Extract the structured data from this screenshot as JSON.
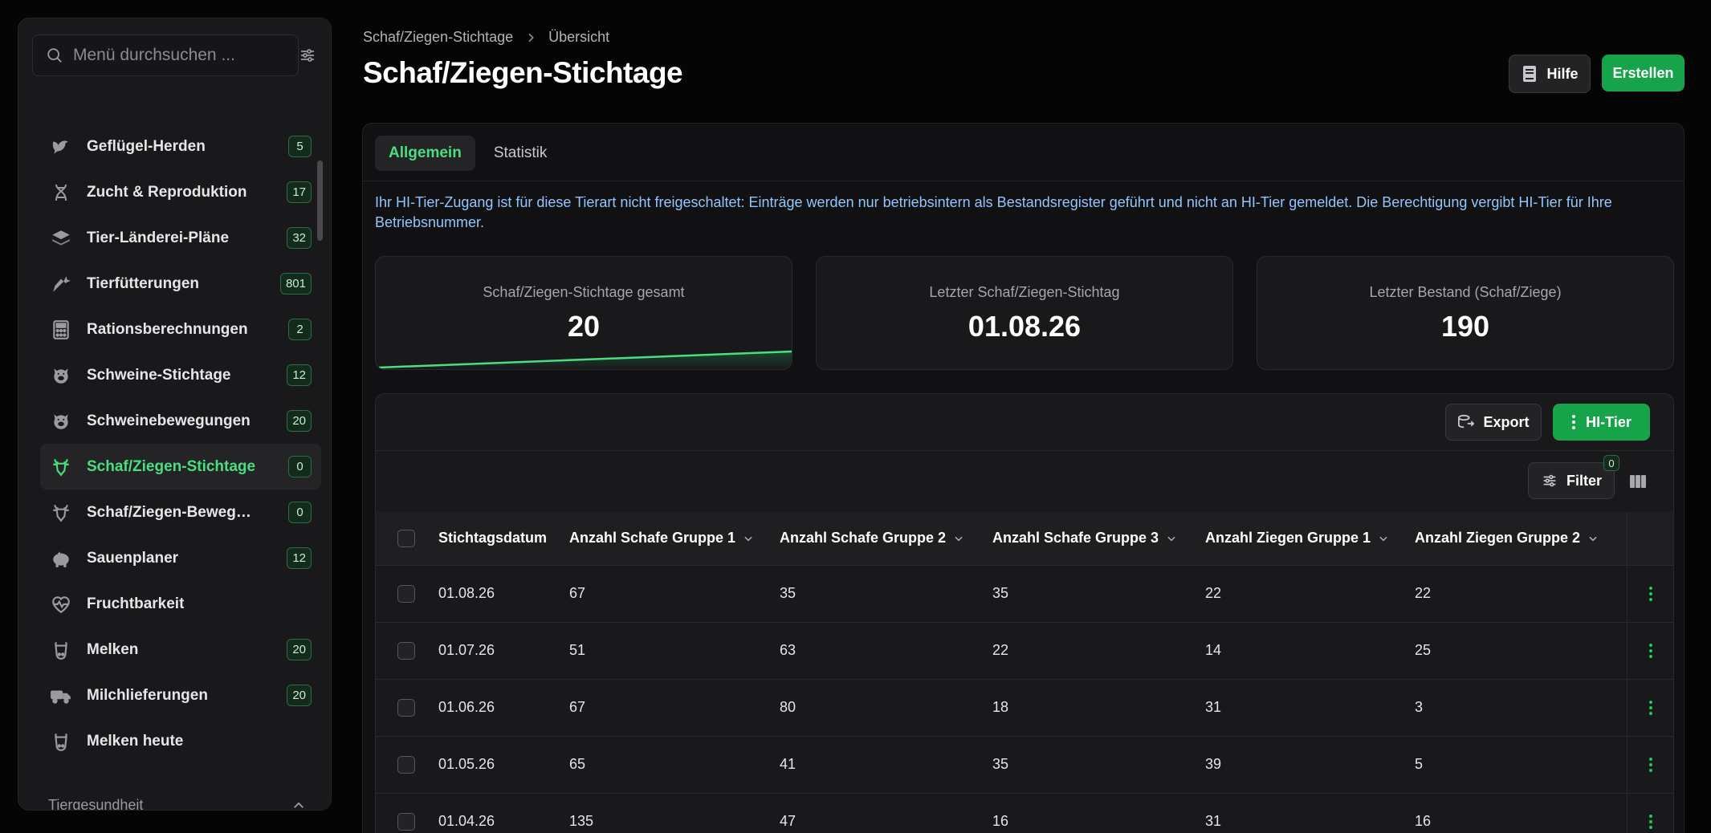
{
  "sidebar": {
    "search_placeholder": "Menü durchsuchen ...",
    "items": [
      {
        "label": "Geflügel-Herden",
        "badge": "5",
        "icon": "bird-icon"
      },
      {
        "label": "Zucht & Reproduktion",
        "badge": "17",
        "icon": "dna-icon"
      },
      {
        "label": "Tier-Länderei-Pläne",
        "badge": "32",
        "icon": "layers-icon"
      },
      {
        "label": "Tierfütterungen",
        "badge": "801",
        "icon": "carrot-icon"
      },
      {
        "label": "Rationsberechnungen",
        "badge": "2",
        "icon": "calculator-icon"
      },
      {
        "label": "Schweine-Stichtage",
        "badge": "12",
        "icon": "pig-icon"
      },
      {
        "label": "Schweinebewegungen",
        "badge": "20",
        "icon": "pig-icon"
      },
      {
        "label": "Schaf/Ziegen-Stichtage",
        "badge": "0",
        "icon": "goat-icon",
        "active": true
      },
      {
        "label": "Schaf/Ziegen-Bewegungen",
        "badge": "0",
        "icon": "goat-icon"
      },
      {
        "label": "Sauenplaner",
        "badge": "12",
        "icon": "piggy-icon"
      },
      {
        "label": "Fruchtbarkeit",
        "badge": "",
        "icon": "heart-pulse-icon"
      },
      {
        "label": "Melken",
        "badge": "20",
        "icon": "cow-icon"
      },
      {
        "label": "Milchlieferungen",
        "badge": "20",
        "icon": "truck-icon"
      },
      {
        "label": "Melken heute",
        "badge": "",
        "icon": "cow-icon"
      }
    ],
    "section_label": "Tiergesundheit"
  },
  "header": {
    "breadcrumb": [
      "Schaf/Ziegen-Stichtage",
      "Übersicht"
    ],
    "title": "Schaf/Ziegen-Stichtage",
    "help_label": "Hilfe",
    "create_label": "Erstellen"
  },
  "tabs": [
    "Allgemein",
    "Statistik"
  ],
  "notice": "Ihr HI-Tier-Zugang ist für diese Tierart nicht freigeschaltet: Einträge werden nur betriebsintern als Bestandsregister geführt und nicht an HI-Tier gemeldet. Die Berechtigung vergibt HI-Tier für Ihre Betriebsnummer.",
  "stats": [
    {
      "label": "Schaf/Ziegen-Stichtage gesamt",
      "value": "20"
    },
    {
      "label": "Letzter Schaf/Ziegen-Stichtag",
      "value": "01.08.26"
    },
    {
      "label": "Letzter Bestand (Schaf/Ziege)",
      "value": "190"
    }
  ],
  "toolbar": {
    "export_label": "Export",
    "hitier_label": "HI-Tier",
    "filter_label": "Filter",
    "filter_count": "0"
  },
  "table": {
    "columns": [
      "Stichtagsdatum",
      "Anzahl Schafe Gruppe 1",
      "Anzahl Schafe Gruppe 2",
      "Anzahl Schafe Gruppe 3",
      "Anzahl Ziegen Gruppe 1",
      "Anzahl Ziegen Gruppe 2"
    ],
    "rows": [
      [
        "01.08.26",
        "67",
        "35",
        "35",
        "22",
        "22"
      ],
      [
        "01.07.26",
        "51",
        "63",
        "22",
        "14",
        "25"
      ],
      [
        "01.06.26",
        "67",
        "80",
        "18",
        "31",
        "3"
      ],
      [
        "01.05.26",
        "65",
        "41",
        "35",
        "39",
        "5"
      ],
      [
        "01.04.26",
        "135",
        "47",
        "16",
        "31",
        "16"
      ]
    ]
  },
  "colors": {
    "accent": "#16a34a",
    "accent_text": "#4ade80",
    "notice_text": "#93c5fd",
    "background": "#050506"
  }
}
